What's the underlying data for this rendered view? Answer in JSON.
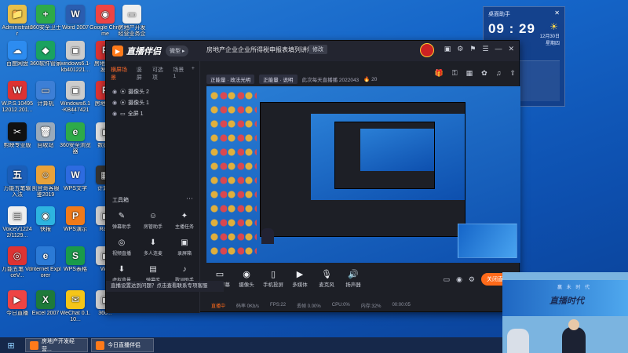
{
  "desktop_icons": [
    {
      "label": "Administrator",
      "color": "#e8c04a",
      "glyph": "📁"
    },
    {
      "label": "360安全卫士",
      "color": "#2eaa4a",
      "glyph": "+"
    },
    {
      "label": "Word 2007",
      "color": "#2a5db0",
      "glyph": "W"
    },
    {
      "label": "Google Chrome",
      "color": "#e44",
      "glyph": "◉"
    },
    {
      "label": "房地产开发经营业务企业...",
      "color": "#eee",
      "glyph": "▭"
    },
    {
      "label": "百度网盘",
      "color": "#2d8cf0",
      "glyph": "☁"
    },
    {
      "label": "360软件管家",
      "color": "#1aa260",
      "glyph": "◆"
    },
    {
      "label": "windows6.1-kb401221...",
      "color": "#ccc",
      "glyph": "▣"
    },
    {
      "label": "房地产开发...",
      "color": "#d33",
      "glyph": "P"
    },
    {
      "label": "W.P.S.10495 12012.201...",
      "color": "#d33",
      "glyph": "W"
    },
    {
      "label": "计算机",
      "color": "#3d7fd6",
      "glyph": "▭"
    },
    {
      "label": "Windows6.1 -KB4474215...",
      "color": "#ccc",
      "glyph": "▣"
    },
    {
      "label": "房地产...",
      "color": "#d33",
      "glyph": "P"
    },
    {
      "label": "剪映专业版",
      "color": "#111",
      "glyph": "✂"
    },
    {
      "label": "回收站",
      "color": "#9ab",
      "glyph": "🗑"
    },
    {
      "label": "360安全浏览器",
      "color": "#2eaa4a",
      "glyph": "e"
    },
    {
      "label": "数据...",
      "color": "#ddd",
      "glyph": "▣"
    },
    {
      "label": "万能五笔输入法",
      "color": "#1b5eb8",
      "glyph": "五"
    },
    {
      "label": "凯登哥客服鉴2019",
      "color": "#e8a23a",
      "glyph": "☺"
    },
    {
      "label": "WPS文字",
      "color": "#2d6be0",
      "glyph": "W"
    },
    {
      "label": "计算...",
      "color": "#333",
      "glyph": "▦"
    },
    {
      "label": "VoiceV1224 2/1129...",
      "color": "#eee",
      "glyph": "▤"
    },
    {
      "label": "快报",
      "color": "#2db4e0",
      "glyph": "◉"
    },
    {
      "label": "WPS演示",
      "color": "#f07a1a",
      "glyph": "P"
    },
    {
      "label": "Ra...",
      "color": "#ccc",
      "glyph": "▣"
    },
    {
      "label": "万能五笔 VoiceV...",
      "color": "#d33",
      "glyph": "◎"
    },
    {
      "label": "Internet Explorer",
      "color": "#2b7ad6",
      "glyph": "e"
    },
    {
      "label": "WPS表格",
      "color": "#1a9a4a",
      "glyph": "S"
    },
    {
      "label": "W...",
      "color": "#ccc",
      "glyph": "▣"
    },
    {
      "label": "今日直播",
      "color": "#e44",
      "glyph": "▶"
    },
    {
      "label": "Excel 2007",
      "color": "#1e7a3a",
      "glyph": "X"
    },
    {
      "label": "WeChat 0.1.10...",
      "color": "#f5c518",
      "glyph": "✉"
    },
    {
      "label": "360...",
      "color": "#ccc",
      "glyph": "▣"
    }
  ],
  "widget": {
    "title": "桌面助手",
    "close": "✕",
    "time": "09 : 29",
    "date_line1": "12月30日",
    "date_line2": "星期四",
    "row1": "我的办公",
    "row2": "文件"
  },
  "app": {
    "name": "直播伴侣",
    "badge": "微型 ▸",
    "window_title": "房地产企业企业所得税申报表填列讲解",
    "title_tag": "修改",
    "meta_tag1": "正能量 · 政法光明",
    "meta_tag2": "正能量 · 说明",
    "meta_text": "此次每天直播播 2022043",
    "meta_count": "🔥 20",
    "controls": [
      "▣",
      "⚙",
      "⚑",
      "☰",
      "—",
      "✕"
    ],
    "scene_tabs": [
      "横屏场景",
      "竖屏",
      "可选项",
      "场景1",
      "+"
    ],
    "sources": [
      {
        "name": "摄像头 2"
      },
      {
        "name": "摄像头 1"
      },
      {
        "name": "全屏 1"
      }
    ],
    "toolbox_title": "工具箱",
    "toolbox_more": "⋯",
    "tools": [
      {
        "icon": "✎",
        "label": "弹幕助手"
      },
      {
        "icon": "☺",
        "label": "房管助手"
      },
      {
        "icon": "✦",
        "label": "主播任务"
      },
      {
        "icon": "◎",
        "label": "视频直播"
      },
      {
        "icon": "⬇",
        "label": "多人连麦"
      },
      {
        "icon": "▣",
        "label": "录屏箱"
      },
      {
        "icon": "⬇",
        "label": "虚拟背景"
      },
      {
        "icon": "▤",
        "label": "弹幕库"
      },
      {
        "icon": "♪",
        "label": "歌词助手"
      }
    ],
    "notice": "直播设置达到问题？点击查看联系专项客服",
    "bottom_tools": [
      {
        "icon": "▭",
        "label": "直播屏幕"
      },
      {
        "icon": "◉",
        "label": "摄像头"
      },
      {
        "icon": "▯",
        "label": "手机投屏"
      },
      {
        "icon": "▶",
        "label": "多媒体"
      },
      {
        "icon": "🎙",
        "label": "麦克风"
      },
      {
        "icon": "🔊",
        "label": "扬声器"
      }
    ],
    "close_live": "关闭直播",
    "status": {
      "live": "直播中",
      "bitrate": "码率 0Kb/s",
      "fps": "FPS:22",
      "dropped": "丢帧 0.00%",
      "cpu": "CPU:0%",
      "memory": "内存:32%",
      "timer": "00:00:05",
      "uptime": "00:00:05"
    }
  },
  "inset": {
    "banner_text": "直播时代",
    "banner_sub": "赢 未 时 代"
  },
  "taskbar": {
    "start": "⊞",
    "tasks": [
      {
        "label": "房地产开发经营..."
      },
      {
        "label": "今日直播伴侣"
      }
    ]
  }
}
